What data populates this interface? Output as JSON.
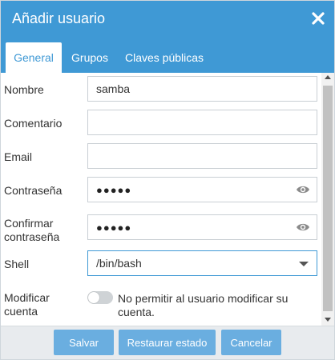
{
  "dialog": {
    "title": "Añadir usuario",
    "close_icon": "close-icon"
  },
  "tabs": [
    {
      "label": "General",
      "active": true
    },
    {
      "label": "Grupos",
      "active": false
    },
    {
      "label": "Claves públicas",
      "active": false
    }
  ],
  "form": {
    "name_label": "Nombre",
    "name_value": "samba",
    "comment_label": "Comentario",
    "comment_value": "",
    "email_label": "Email",
    "email_value": "",
    "password_label": "Contraseña",
    "password_value": "●●●●●",
    "confirm_label_line1": "Confirmar",
    "confirm_label_line2": "contraseña",
    "confirm_value": "●●●●●",
    "shell_label": "Shell",
    "shell_value": "/bin/bash",
    "modify_label_line1": "Modificar",
    "modify_label_line2": "cuenta",
    "modify_toggle_on": false,
    "modify_text_line1": "No permitir al usuario modificar su",
    "modify_text_line2": "cuenta."
  },
  "footer": {
    "save": "Salvar",
    "reset": "Restaurar estado",
    "cancel": "Cancelar"
  },
  "colors": {
    "header": "#3f99d5",
    "button": "#6aaee0",
    "footer_bg": "#e8ebee"
  }
}
